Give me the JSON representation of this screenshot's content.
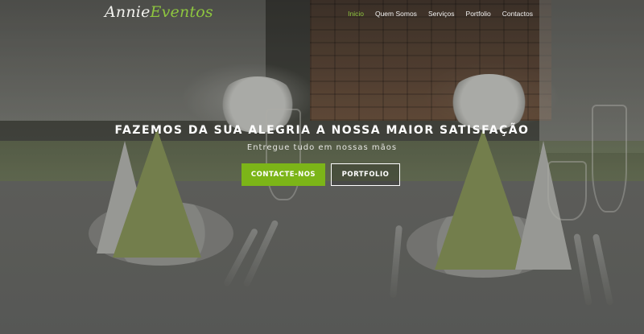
{
  "brand": {
    "logo_part1": "Annie",
    "logo_part2": "Eventos",
    "accent_color": "#8ec63f"
  },
  "nav": {
    "items": [
      {
        "label": "Inicio",
        "active": true
      },
      {
        "label": "Quem Somos"
      },
      {
        "label": "Serviços"
      },
      {
        "label": "Portfolio"
      },
      {
        "label": "Contactos"
      }
    ]
  },
  "hero": {
    "headline": "FAZEMOS DA SUA ALEGRIA A NOSSA MAIOR SATISFAÇÃO",
    "subline": "Entregue tudo em nossas mãos",
    "primary_button": "CONTACTE-NOS",
    "secondary_button": "PORTFOLIO",
    "primary_color": "#7cb518"
  }
}
